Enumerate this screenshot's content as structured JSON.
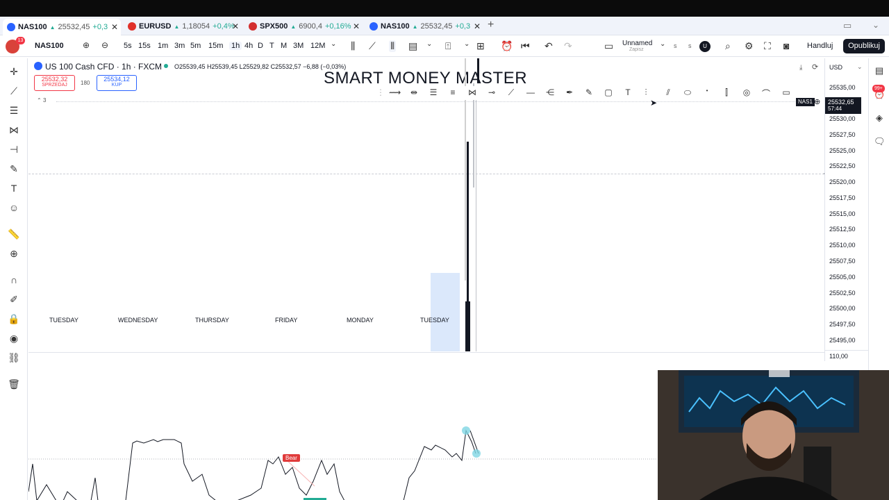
{
  "tabs": [
    {
      "symbol": "NAS100",
      "price": "25532,45",
      "change": "+0,3",
      "flag_color": "#2962ff",
      "active": true
    },
    {
      "symbol": "EURUSD",
      "price": "1,18054",
      "change": "+0,4%",
      "flag_color": "#e0302a",
      "active": false
    },
    {
      "symbol": "SPX500",
      "price": "6900,4",
      "change": "+0,16%",
      "flag_color": "#d32f2f",
      "active": false
    },
    {
      "symbol": "NAS100",
      "price": "25532,45",
      "change": "+0,3",
      "flag_color": "#2962ff",
      "active": false
    }
  ],
  "toolbar": {
    "avatar_badge": "13",
    "symbol": "NAS100",
    "intervals": [
      "5s",
      "15s",
      "1m",
      "3m",
      "5m",
      "15m",
      "1h",
      "4h",
      "D",
      "T",
      "M",
      "3M",
      "12M"
    ],
    "active_interval": "1h",
    "layout_name": "Unnamed",
    "layout_sub": "Zapisz",
    "trade_label": "Handluj",
    "publish_label": "Opublikuj"
  },
  "legend": {
    "title": "US 100 Cash CFD · 1h · FXCM",
    "ohlc": "O25539,45 H25539,45 L25529,82 C25532,57 −6,88 (−0,03%)",
    "sell_price": "25532,32",
    "sell_label": "SPRZEDAJ",
    "spread": "180",
    "buy_price": "25534,12",
    "buy_label": "KUP",
    "indicator_count": "3"
  },
  "watermark": "SMART MONEY MASTER",
  "days": [
    "TUESDAY",
    "WEDNESDAY",
    "THURSDAY",
    "FRIDAY",
    "MONDAY",
    "TUESDAY"
  ],
  "price_axis": {
    "currency": "USD",
    "labels": [
      "25535,00",
      "25532,65",
      "25530,00",
      "25527,50",
      "25525,00",
      "25522,50",
      "25520,00",
      "25517,50",
      "25515,00",
      "25512,50",
      "25510,00",
      "25507,50",
      "25505,00",
      "25502,50",
      "25500,00",
      "25497,50",
      "25495,00",
      "110,00"
    ],
    "current_price": "25532,65",
    "countdown": "57:44",
    "tag": "NAS1"
  },
  "indicator": {
    "bear_label": "Bear"
  },
  "right_badge": "99+",
  "colors": {
    "accent": "#2962ff",
    "sell": "#f23645",
    "buy": "#2962ff",
    "up": "#22ab94",
    "bear": "#e03b3b"
  }
}
